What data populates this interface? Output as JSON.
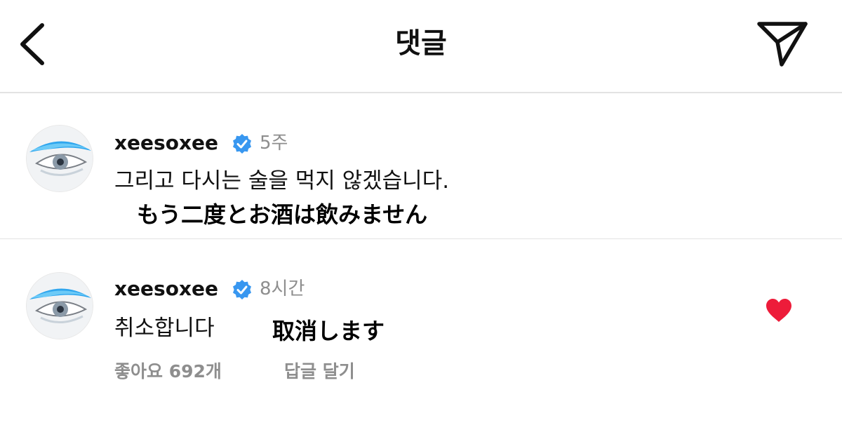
{
  "header": {
    "title": "댓글"
  },
  "comments": [
    {
      "username": "xeesoxee",
      "time": "5주",
      "text": "그리고 다시는 술을 먹지 않겠습니다.",
      "overlay": "もう二度とお酒は飲みません"
    },
    {
      "username": "xeesoxee",
      "time": "8시간",
      "text": "취소합니다",
      "overlay": "取消します",
      "likes_label": "좋아요 692개",
      "reply_label": "답글 달기",
      "liked": true
    }
  ],
  "colors": {
    "verified": "#3897f0",
    "heart": "#ed1c3a",
    "secondary_text": "#8e8e8e"
  }
}
